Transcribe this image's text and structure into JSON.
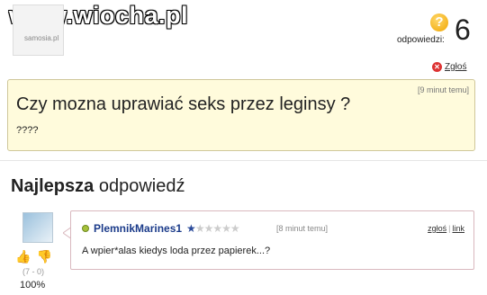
{
  "watermark": {
    "text": "www.wiocha.pl"
  },
  "avatar_top": {
    "caption": "samosia.pl"
  },
  "question_meta": {
    "answers_label": "odpowiedzi:",
    "answers_count": "6",
    "report_label": "Zgłoś"
  },
  "question": {
    "time": "[9 minut temu]",
    "title": "Czy mozna uprawiać seks przez leginsy ?",
    "body": "????"
  },
  "best_answer": {
    "heading_bold": "Najlepsza",
    "heading_rest": "odpowiedź",
    "username": "PlemnikMarines1",
    "rating_stars": 1,
    "rating_max": 6,
    "time": "[8 minut temu]",
    "report_label": "zgłoś",
    "link_label": "link",
    "text": "A wpier*alas kiedys loda przez papierek...?",
    "votes": "(7 - 0)",
    "percent": "100%"
  }
}
